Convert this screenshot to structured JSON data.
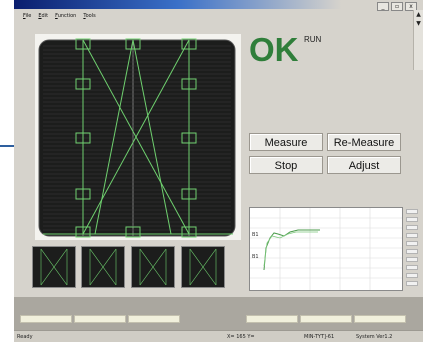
{
  "window": {
    "minimize_glyph": "_",
    "restore_glyph": "▫",
    "close_glyph": "x"
  },
  "menu": {
    "items": [
      "File",
      "Edit",
      "Function",
      "Tools"
    ]
  },
  "side_scrollbar": {
    "up": "▲",
    "down": "▼"
  },
  "status": {
    "result": "OK",
    "mode": "RUN",
    "result_color": "#2f7e3a"
  },
  "buttons": {
    "measure": "Measure",
    "remeasure": "Re-Measure",
    "stop": "Stop",
    "adjust": "Adjust"
  },
  "graph": {
    "label_a": "B1",
    "label_b": "B1"
  },
  "statusbar": {
    "ready": "Ready",
    "coords": "X= 165 Y=",
    "device": "MIN-TYT]-61",
    "system": "System Ver1.2"
  },
  "colors": {
    "overlay_green": "#6fd06f",
    "cell_dark": "#1c1d1c",
    "accent_blue": "#2e5f9e"
  }
}
